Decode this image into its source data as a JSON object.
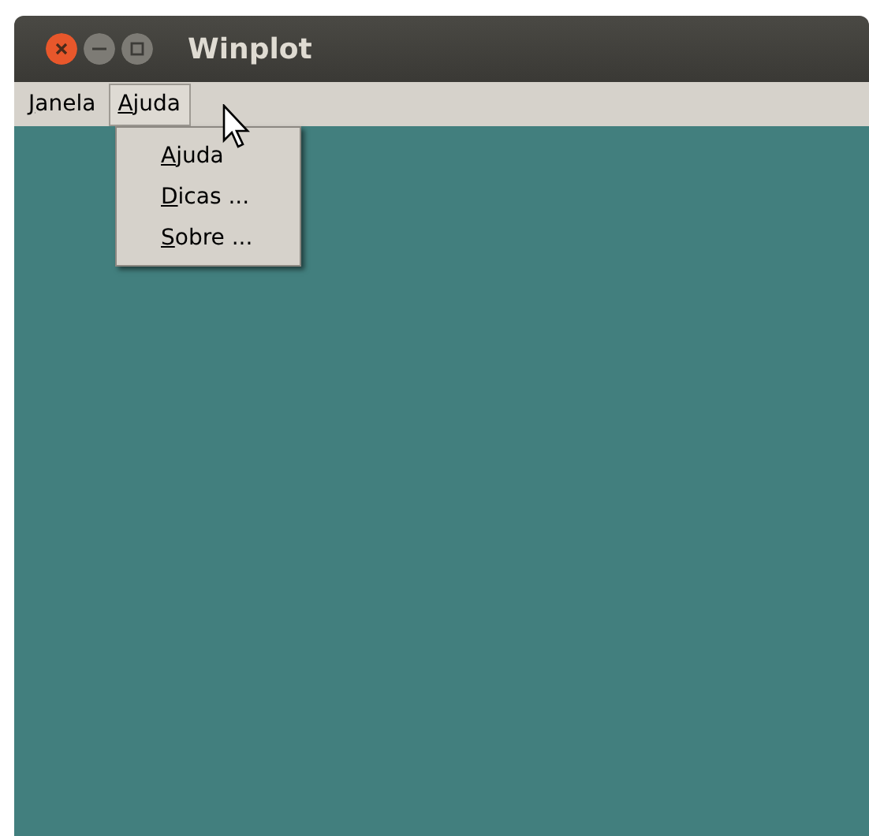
{
  "window": {
    "title": "Winplot"
  },
  "menubar": [
    {
      "mnemonic": "J",
      "rest": "anela",
      "selected": false
    },
    {
      "mnemonic": "A",
      "rest": "juda",
      "selected": true
    }
  ],
  "open_menu": {
    "items": [
      {
        "mnemonic": "A",
        "rest": "juda"
      },
      {
        "mnemonic": "D",
        "rest": "icas ..."
      },
      {
        "mnemonic": "S",
        "rest": "obre ..."
      }
    ]
  }
}
